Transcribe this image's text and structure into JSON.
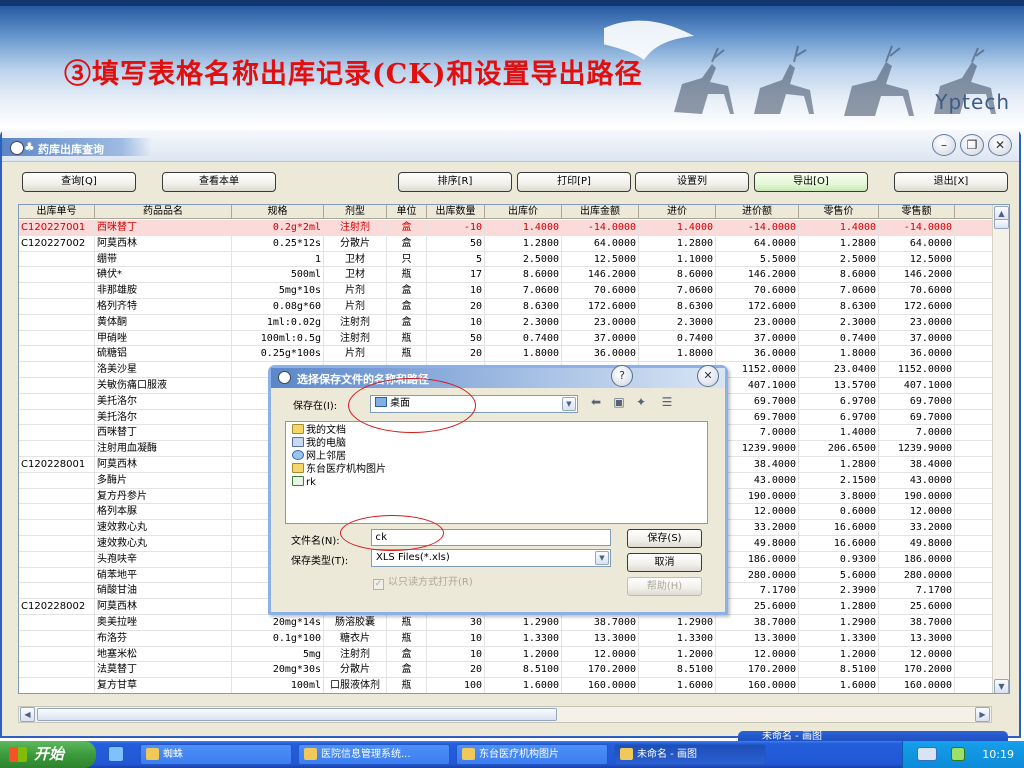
{
  "slide": {
    "title": "③填写表格名称出库记录(CK)和设置导出路径",
    "brand": "Yptech"
  },
  "window": {
    "title": "药库出库查询",
    "controls": {
      "minimize": "–",
      "restore": "❐",
      "close": "✕"
    }
  },
  "toolbar": {
    "query": "查询[Q]",
    "view_doc": "查看本单",
    "sort": "排序[R]",
    "print": "打印[P]",
    "set_agent": "设置列",
    "export": "导出[O]",
    "exit": "退出[X]"
  },
  "table": {
    "headers": [
      "出库单号",
      "药品品名",
      "规格",
      "剂型",
      "单位",
      "出库数量",
      "出库价",
      "出库金额",
      "进价",
      "进价额",
      "零售价",
      "零售额"
    ],
    "rows": [
      [
        "C120227001",
        "西咪替丁",
        "0.2g*2ml",
        "注射剂",
        "盒",
        "-10",
        "1.4000",
        "-14.0000",
        "1.4000",
        "-14.0000",
        "1.4000",
        "-14.0000"
      ],
      [
        "C120227002",
        "阿莫西林",
        "0.25*12s",
        "分散片",
        "盒",
        "50",
        "1.2800",
        "64.0000",
        "1.2800",
        "64.0000",
        "1.2800",
        "64.0000"
      ],
      [
        "",
        "绷带",
        "1",
        "卫材",
        "只",
        "5",
        "2.5000",
        "12.5000",
        "1.1000",
        "5.5000",
        "2.5000",
        "12.5000"
      ],
      [
        "",
        "碘伏*",
        "500ml",
        "卫材",
        "瓶",
        "17",
        "8.6000",
        "146.2000",
        "8.6000",
        "146.2000",
        "8.6000",
        "146.2000"
      ],
      [
        "",
        "非那雄胺",
        "5mg*10s",
        "片剂",
        "盒",
        "10",
        "7.0600",
        "70.6000",
        "7.0600",
        "70.6000",
        "7.0600",
        "70.6000"
      ],
      [
        "",
        "格列齐特",
        "0.08g*60",
        "片剂",
        "盒",
        "20",
        "8.6300",
        "172.6000",
        "8.6300",
        "172.6000",
        "8.6300",
        "172.6000"
      ],
      [
        "",
        "黄体酮",
        "1ml:0.02g",
        "注射剂",
        "盒",
        "10",
        "2.3000",
        "23.0000",
        "2.3000",
        "23.0000",
        "2.3000",
        "23.0000"
      ],
      [
        "",
        "甲硝唑",
        "100ml:0.5g",
        "注射剂",
        "瓶",
        "50",
        "0.7400",
        "37.0000",
        "0.7400",
        "37.0000",
        "0.7400",
        "37.0000"
      ],
      [
        "",
        "硫糖铝",
        "0.25g*100s",
        "片剂",
        "瓶",
        "20",
        "1.8000",
        "36.0000",
        "1.8000",
        "36.0000",
        "1.8000",
        "36.0000"
      ],
      [
        "",
        "洛美沙星",
        "",
        "",
        "",
        "",
        "",
        "",
        "",
        "1152.0000",
        "23.0400",
        "1152.0000"
      ],
      [
        "",
        "关敏伤痛口服液",
        "",
        "",
        "",
        "",
        "",
        "",
        "",
        "407.1000",
        "13.5700",
        "407.1000"
      ],
      [
        "",
        "美托洛尔",
        "",
        "",
        "",
        "",
        "",
        "",
        "",
        "69.7000",
        "6.9700",
        "69.7000"
      ],
      [
        "",
        "美托洛尔",
        "",
        "",
        "",
        "",
        "",
        "",
        "",
        "69.7000",
        "6.9700",
        "69.7000"
      ],
      [
        "",
        "西咪替丁",
        "",
        "",
        "",
        "",
        "",
        "",
        "",
        "7.0000",
        "1.4000",
        "7.0000"
      ],
      [
        "",
        "注射用血凝酶",
        "",
        "",
        "",
        "",
        "",
        "",
        "",
        "1239.9000",
        "206.6500",
        "1239.9000"
      ],
      [
        "C120228001",
        "阿莫西林",
        "",
        "",
        "",
        "",
        "",
        "",
        "",
        "38.4000",
        "1.2800",
        "38.4000"
      ],
      [
        "",
        "多酶片",
        "",
        "",
        "",
        "",
        "",
        "",
        "",
        "43.0000",
        "2.1500",
        "43.0000"
      ],
      [
        "",
        "复方丹参片",
        "",
        "",
        "",
        "",
        "",
        "",
        "",
        "190.0000",
        "3.8000",
        "190.0000"
      ],
      [
        "",
        "格列本脲",
        "",
        "",
        "",
        "",
        "",
        "",
        "",
        "12.0000",
        "0.6000",
        "12.0000"
      ],
      [
        "",
        "速效救心丸",
        "",
        "",
        "",
        "",
        "",
        "",
        "",
        "33.2000",
        "16.6000",
        "33.2000"
      ],
      [
        "",
        "速效救心丸",
        "",
        "",
        "",
        "",
        "",
        "",
        "",
        "49.8000",
        "16.6000",
        "49.8000"
      ],
      [
        "",
        "头孢呋辛",
        "",
        "",
        "",
        "",
        "",
        "",
        "",
        "186.0000",
        "0.9300",
        "186.0000"
      ],
      [
        "",
        "硝苯地平",
        "",
        "",
        "",
        "",
        "",
        "",
        "",
        "280.0000",
        "5.6000",
        "280.0000"
      ],
      [
        "",
        "硝酸甘油",
        "",
        "",
        "",
        "",
        "",
        "",
        "",
        "7.1700",
        "2.3900",
        "7.1700"
      ],
      [
        "C120228002",
        "阿莫西林",
        "",
        "",
        "",
        "",
        "",
        "",
        "",
        "25.6000",
        "1.2800",
        "25.6000"
      ],
      [
        "",
        "奥美拉唑",
        "20mg*14s",
        "肠溶胶囊",
        "瓶",
        "30",
        "1.2900",
        "38.7000",
        "1.2900",
        "38.7000",
        "1.2900",
        "38.7000"
      ],
      [
        "",
        "布洛芬",
        "0.1g*100",
        "糖衣片",
        "瓶",
        "10",
        "1.3300",
        "13.3000",
        "1.3300",
        "13.3000",
        "1.3300",
        "13.3000"
      ],
      [
        "",
        "地塞米松",
        "5mg",
        "注射剂",
        "盒",
        "10",
        "1.2000",
        "12.0000",
        "1.2000",
        "12.0000",
        "1.2000",
        "12.0000"
      ],
      [
        "",
        "法莫替丁",
        "20mg*30s",
        "分散片",
        "盒",
        "20",
        "8.5100",
        "170.2000",
        "8.5100",
        "170.2000",
        "8.5100",
        "170.2000"
      ],
      [
        "",
        "复方甘草",
        "100ml",
        "口服液体剂",
        "瓶",
        "100",
        "1.6000",
        "160.0000",
        "1.6000",
        "160.0000",
        "1.6000",
        "160.0000"
      ]
    ],
    "selected_row": 0
  },
  "save_dialog": {
    "title": "选择保存文件的名称和路径",
    "save_in_label": "保存在(I):",
    "save_in_value": "桌面",
    "files": [
      {
        "icon": "folder-icon",
        "name": "我的文档"
      },
      {
        "icon": "computer-icon",
        "name": "我的电脑"
      },
      {
        "icon": "network-icon",
        "name": "网上邻居"
      },
      {
        "icon": "folder-icon",
        "name": "东台医疗机构图片"
      },
      {
        "icon": "excel-file-icon",
        "name": "rk"
      }
    ],
    "filename_label": "文件名(N):",
    "filename_value": "ck",
    "filetype_label": "保存类型(T):",
    "filetype_value": "XLS Files(*.xls)",
    "readonly_label": "以只读方式打开(R)",
    "save_button": "保存(S)",
    "cancel_button": "取消",
    "help_button": "帮助(H)"
  },
  "taskbar": {
    "start": "开始",
    "tasks": [
      "蜘蛛",
      "医院信息管理系统...",
      "东台医疗机构图片",
      "未命名 - 画图"
    ],
    "peek_title": "未命名 - 画图",
    "clock": "10:19"
  },
  "colors": {
    "title_red": "#e01010",
    "selected_row_text": "#d40000",
    "xp_blue": "#245edb",
    "annotation": "#d51a1a"
  }
}
